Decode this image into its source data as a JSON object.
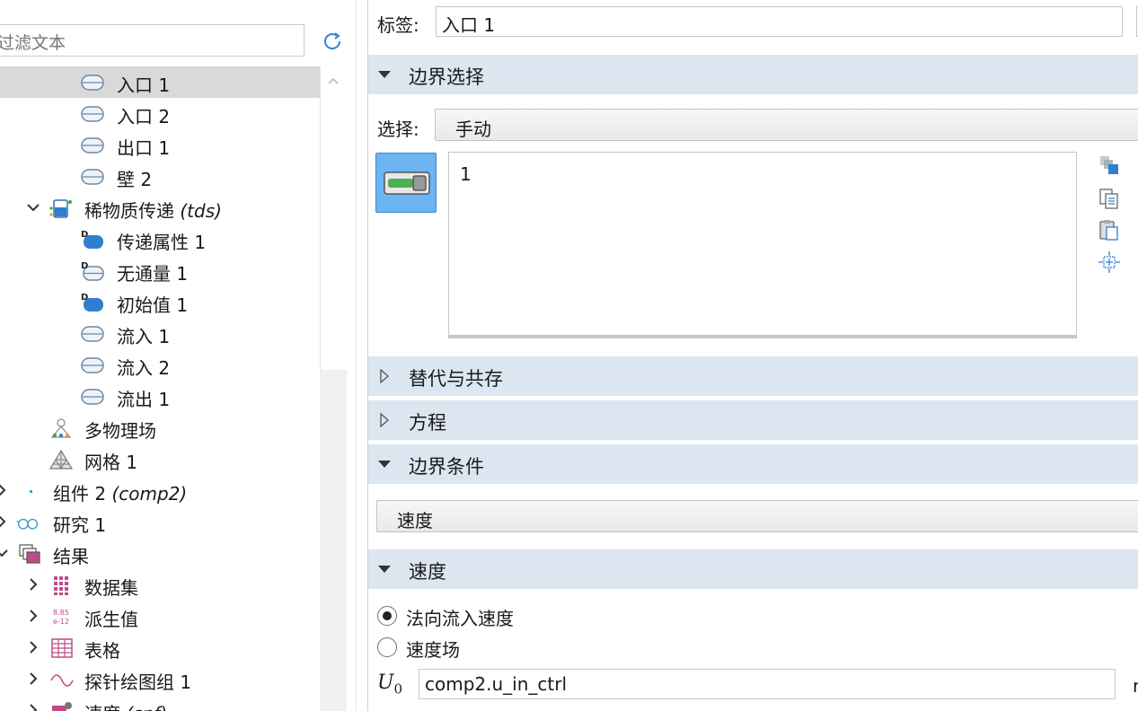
{
  "left_panel": {
    "filter_placeholder": "过滤文本",
    "tree": [
      {
        "label": "入口 1",
        "icon": "boundary-icon",
        "selected": true
      },
      {
        "label": "入口 2",
        "icon": "boundary-icon"
      },
      {
        "label": "出口 1",
        "icon": "boundary-icon"
      },
      {
        "label": "壁 2",
        "icon": "boundary-icon"
      },
      {
        "label": "稀物质传递",
        "italic": "(tds)",
        "icon": "species-transport-icon",
        "expanded": true
      },
      {
        "label": "传递属性 1",
        "icon": "domain-default-icon"
      },
      {
        "label": "无通量 1",
        "icon": "boundary-default-icon"
      },
      {
        "label": "初始值 1",
        "icon": "domain-default-icon"
      },
      {
        "label": "流入 1",
        "icon": "boundary-icon"
      },
      {
        "label": "流入 2",
        "icon": "boundary-icon"
      },
      {
        "label": "流出 1",
        "icon": "boundary-icon"
      },
      {
        "label": "多物理场",
        "icon": "multiphysics-icon"
      },
      {
        "label": "网格 1",
        "icon": "mesh-icon"
      },
      {
        "label": "组件 2",
        "italic": "(comp2)",
        "icon": "component-icon",
        "expanded": false
      },
      {
        "label": "研究 1",
        "icon": "study-icon",
        "expanded": false
      },
      {
        "label": "结果",
        "icon": "results-icon",
        "expanded": true
      },
      {
        "label": "数据集",
        "icon": "datasets-icon",
        "expanded": false
      },
      {
        "label": "派生值",
        "icon": "derived-values-icon",
        "expanded": false
      },
      {
        "label": "表格",
        "icon": "tables-icon",
        "expanded": false
      },
      {
        "label": "探针绘图组 1",
        "icon": "probe-plot-icon",
        "expanded": false
      },
      {
        "label": "速度",
        "italic": "(spf)",
        "icon": "plot-group-icon",
        "expanded": false
      }
    ]
  },
  "right_panel": {
    "label_caption": "标签:",
    "label_value": "入口 1",
    "section_boundary_selection": "边界选择",
    "selection_caption": "选择:",
    "selection_mode": "手动",
    "selection_items": [
      "1"
    ],
    "section_override": "替代与共存",
    "section_equation": "方程",
    "section_boundary_condition": "边界条件",
    "boundary_condition_value": "速度",
    "section_velocity": "速度",
    "radio_options": [
      {
        "label": "法向流入速度",
        "checked": true
      },
      {
        "label": "速度场",
        "checked": false
      }
    ],
    "u0_symbol": "U",
    "u0_subscript": "0",
    "u0_value": "comp2.u_in_ctrl",
    "u0_unit_partial": "r"
  },
  "colors": {
    "section_bg": "#dce6f0",
    "selected_row": "#d9d9d9",
    "accent_blue": "#6cb4f2",
    "green_toggle": "#4caf50"
  }
}
